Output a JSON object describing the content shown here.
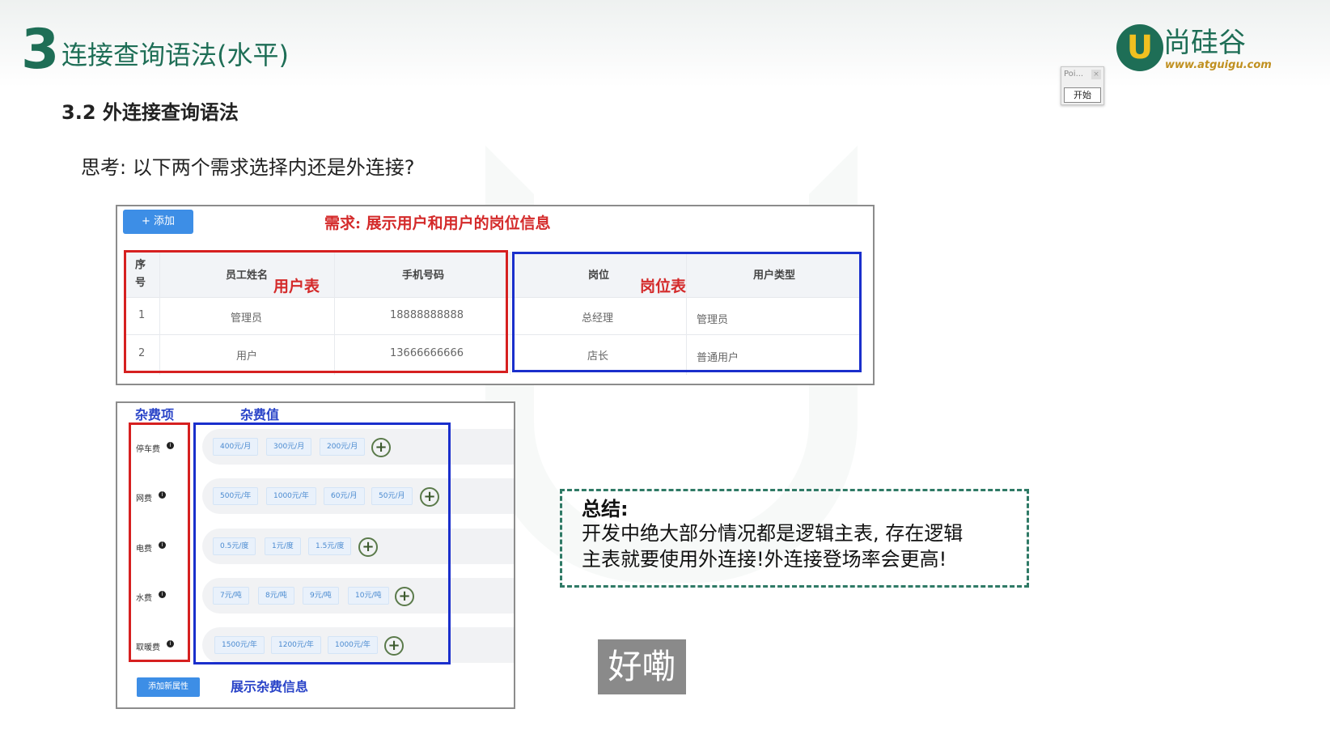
{
  "header": {
    "section_number": "3",
    "section_title": "连接查询语法(水平)",
    "logo_mark": "U",
    "logo_text": "尚硅谷",
    "logo_url": "www.atguigu.com"
  },
  "mini_window": {
    "title": "Poi...",
    "close": "×",
    "start_button": "开始"
  },
  "subsection_title": "3.2 外连接查询语法",
  "question": "思考: 以下两个需求选择内还是外连接?",
  "panel1": {
    "add_button": "+ 添加",
    "requirement": "需求: 展示用户和用户的岗位信息",
    "annotation_user_table": "用户表",
    "annotation_position_table": "岗位表",
    "headers": [
      "序号",
      "员工姓名",
      "手机号码",
      "岗位",
      "用户类型"
    ],
    "rows": [
      [
        "1",
        "管理员",
        "18888888888",
        "总经理",
        "管理员"
      ],
      [
        "2",
        "用户",
        "13666666666",
        "店长",
        "普通用户"
      ]
    ]
  },
  "panel2": {
    "label_items": "杂费项",
    "label_values": "杂费值",
    "info_icon": "i",
    "plus_icon": "+",
    "rows": [
      {
        "name": "停车费",
        "chips": [
          "400元/月",
          "300元/月",
          "200元/月"
        ]
      },
      {
        "name": "网费",
        "chips": [
          "500元/年",
          "1000元/年",
          "60元/月",
          "50元/月"
        ]
      },
      {
        "name": "电费",
        "chips": [
          "0.5元/度",
          "1元/度",
          "1.5元/度"
        ]
      },
      {
        "name": "水费",
        "chips": [
          "7元/吨",
          "8元/吨",
          "9元/吨",
          "10元/吨"
        ]
      },
      {
        "name": "取暖费",
        "chips": [
          "1500元/年",
          "1200元/年",
          "1000元/年"
        ]
      }
    ],
    "add_attr_button": "添加新属性",
    "show_info": "展示杂费信息"
  },
  "summary": {
    "title": "总结:",
    "line1": "开发中绝大部分情况都是逻辑主表, 存在逻辑",
    "line2": "主表就要使用外连接!外连接登场率会更高!"
  },
  "caption": "好嘞"
}
